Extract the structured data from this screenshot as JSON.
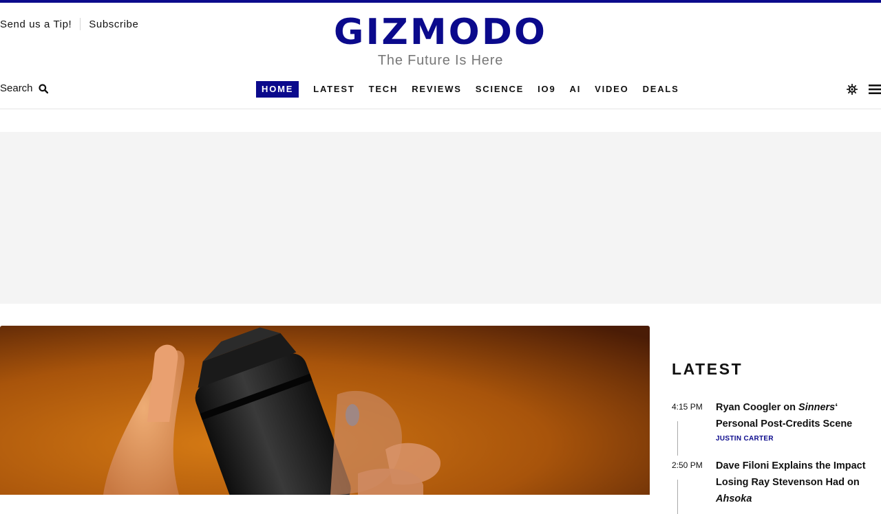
{
  "header": {
    "tip_label": "Send us a Tip!",
    "subscribe_label": "Subscribe",
    "logo_text": "GIZMODO",
    "tagline": "The Future Is Here",
    "search_label": "Search",
    "brand_color": "#0b0a8c"
  },
  "nav": {
    "items": [
      {
        "label": "HOME",
        "active": true
      },
      {
        "label": "LATEST"
      },
      {
        "label": "TECH"
      },
      {
        "label": "REVIEWS"
      },
      {
        "label": "SCIENCE"
      },
      {
        "label": "IO9"
      },
      {
        "label": "AI"
      },
      {
        "label": "VIDEO"
      },
      {
        "label": "DEALS"
      }
    ]
  },
  "icons": {
    "search": "search-icon",
    "theme": "sun-icon",
    "menu": "hamburger-menu-icon"
  },
  "latest": {
    "heading": "LATEST",
    "stories": [
      {
        "time": "4:15 PM",
        "title_parts": [
          "Ryan Coogler on ",
          "Sinners",
          "‘ Personal Post-Credits Scene"
        ],
        "author": "JUSTIN CARTER"
      },
      {
        "time": "2:50 PM",
        "title_parts": [
          "Dave Filoni Explains the Impact Losing Ray Stevenson Had on ",
          "Ahsoka",
          ""
        ],
        "author": ""
      }
    ]
  }
}
